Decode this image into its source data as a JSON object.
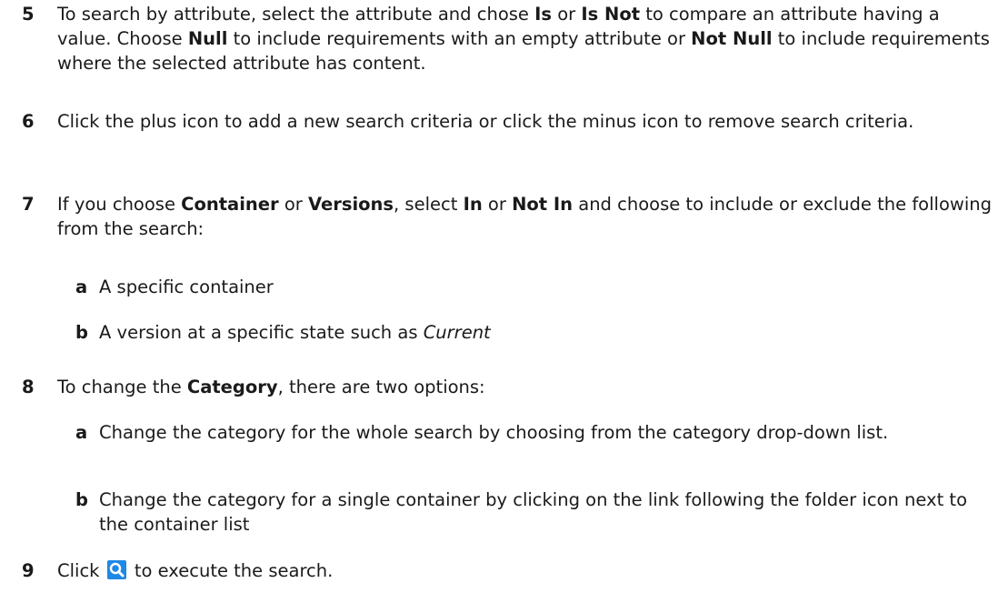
{
  "steps": [
    {
      "num": "5",
      "parts": [
        {
          "t": "To search by attribute, select the attribute and chose "
        },
        {
          "t": "Is",
          "b": true
        },
        {
          "t": " or "
        },
        {
          "t": "Is Not",
          "b": true
        },
        {
          "t": " to compare an attribute having a value. Choose "
        },
        {
          "t": "Null",
          "b": true
        },
        {
          "t": " to include requirements with an empty attribute or "
        },
        {
          "t": "Not Null",
          "b": true
        },
        {
          "t": " to include requirements where the selected attribute has content."
        }
      ]
    },
    {
      "num": "6",
      "parts": [
        {
          "t": "Click the plus icon to add a new search criteria or click the minus icon to remove search criteria."
        }
      ]
    },
    {
      "num": "7",
      "parts": [
        {
          "t": "If you choose "
        },
        {
          "t": "Container",
          "b": true
        },
        {
          "t": " or "
        },
        {
          "t": "Versions",
          "b": true
        },
        {
          "t": ", select "
        },
        {
          "t": "In",
          "b": true
        },
        {
          "t": " or "
        },
        {
          "t": "Not In",
          "b": true
        },
        {
          "t": " and choose to include or exclude the following from the search:"
        }
      ],
      "sub": [
        {
          "letter": "a",
          "parts": [
            {
              "t": "A specific container"
            }
          ]
        },
        {
          "letter": "b",
          "parts": [
            {
              "t": "A version at a specific state such as "
            },
            {
              "t": "Current",
              "i": true
            }
          ]
        }
      ]
    },
    {
      "num": "8",
      "parts": [
        {
          "t": "To change the "
        },
        {
          "t": "Category",
          "b": true
        },
        {
          "t": ", there are two options:"
        }
      ],
      "sub": [
        {
          "letter": "a",
          "parts": [
            {
              "t": "Change the category for the whole search by choosing from the category drop-down list."
            }
          ]
        },
        {
          "letter": "b",
          "parts": [
            {
              "t": "Change the category for a single container by clicking on the link following the folder icon next to the container list"
            }
          ]
        }
      ]
    },
    {
      "num": "9",
      "parts": [
        {
          "t": "Click "
        },
        {
          "icon": "search-icon"
        },
        {
          "t": " to execute the search."
        }
      ]
    }
  ],
  "colors": {
    "text": "#1a1a1a",
    "icon_bg": "#1e88e5",
    "icon_fg": "#ffffff"
  }
}
